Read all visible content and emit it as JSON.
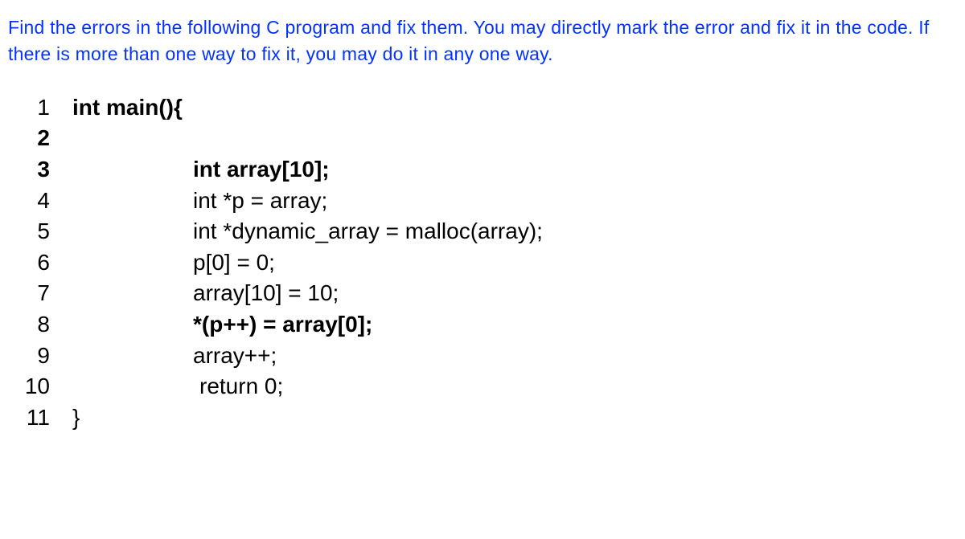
{
  "instruction": "Find the errors in the following C program and fix them. You may directly mark the error and fix it in the code. If there is more than one way to fix it, you may do it in any one way.",
  "code": {
    "lines": [
      {
        "num": "1",
        "text": "int main(){",
        "bold": true,
        "indent": false
      },
      {
        "num": "2",
        "text": "",
        "bold": false,
        "indent": false
      },
      {
        "num": "3",
        "text": "int array[10];",
        "bold": true,
        "indent": true
      },
      {
        "num": "4",
        "text": "int *p = array;",
        "bold": false,
        "indent": true
      },
      {
        "num": "5",
        "text": "int *dynamic_array = malloc(array);",
        "bold": false,
        "indent": true
      },
      {
        "num": "6",
        "text": "p[0] = 0;",
        "bold": false,
        "indent": true
      },
      {
        "num": "7",
        "text": "array[10] = 10;",
        "bold": false,
        "indent": true
      },
      {
        "num": "8",
        "text": "*(p++) = array[0];",
        "bold": true,
        "indent": true
      },
      {
        "num": "9",
        "text": "array++;",
        "bold": false,
        "indent": true
      },
      {
        "num": "10",
        "text": "return 0;",
        "bold": false,
        "indent": true,
        "returnIndent": true
      },
      {
        "num": "11",
        "text": "}",
        "bold": false,
        "indent": false
      }
    ]
  }
}
